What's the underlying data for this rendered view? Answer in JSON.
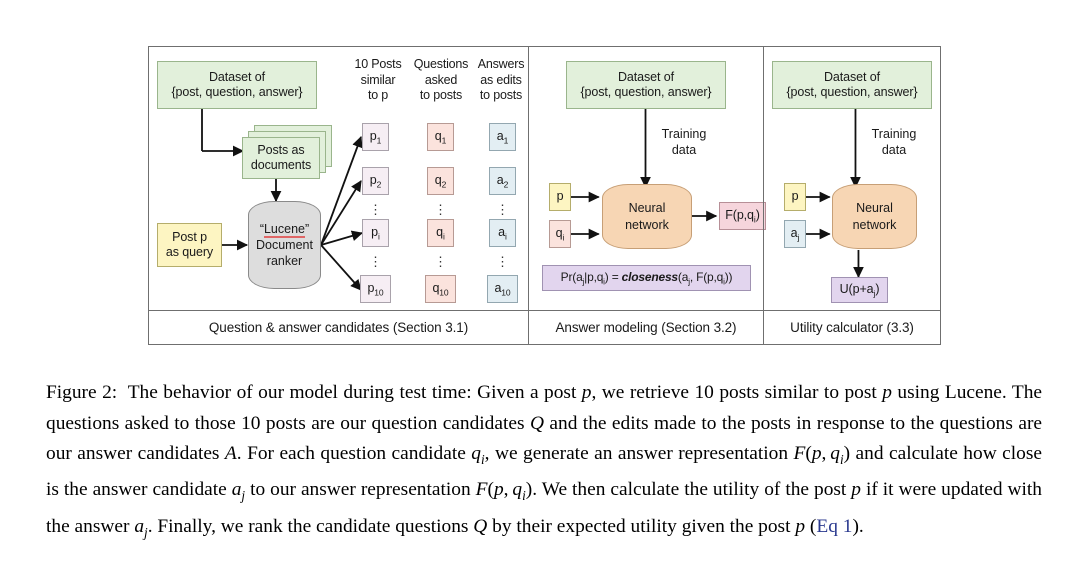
{
  "figure": {
    "panels": [
      {
        "id": "candidates",
        "footer": "Question & answer candidates (Section 3.1)",
        "dataset_box": "Dataset of\n{post, question, answer}",
        "dataset_line1": "Dataset of",
        "dataset_line2": "{post, question, answer}",
        "posts_line1": "Posts as",
        "posts_line2": "documents",
        "query_line1": "Post p",
        "query_line2": "as query",
        "ranker_line1": "“Lucene”",
        "ranker_line1_word": "Lucene",
        "ranker_line2": "Document",
        "ranker_line3": "ranker",
        "col_headers": [
          "10 Posts\nsimilar\nto p",
          "Questions\nasked\nto posts",
          "Answers\nas edits\nto posts"
        ],
        "col_header_posts": [
          "10 Posts",
          "similar",
          "to p"
        ],
        "col_header_questions": [
          "Questions",
          "asked",
          "to posts"
        ],
        "col_header_answers": [
          "Answers",
          "as edits",
          "to posts"
        ],
        "posts_column": [
          "p1",
          "p2",
          "pi",
          "p10"
        ],
        "questions_column": [
          "q1",
          "q2",
          "qi",
          "q10"
        ],
        "answers_column": [
          "a1",
          "a2",
          "ai",
          "a10"
        ],
        "ellipsis": "⋮"
      },
      {
        "id": "answer-modeling",
        "footer": "Answer modeling (Section 3.2)",
        "dataset_line1": "Dataset of",
        "dataset_line2": "{post, question, answer}",
        "training_line1": "Training",
        "training_line2": "data",
        "input_p": "p",
        "input_qi": "qi",
        "network_line1": "Neural",
        "network_line2": "network",
        "output": "F(p,qi)",
        "equation": "Pr(aj|p,qi) = closeness(aj, F(p,qi))",
        "equation_prefix": "Pr(a",
        "equation_emph": "closeness"
      },
      {
        "id": "utility",
        "footer": "Utility calculator (3.3)",
        "dataset_line1": "Dataset of",
        "dataset_line2": "{post, question, answer}",
        "training_line1": "Training",
        "training_line2": "data",
        "input_p": "p",
        "input_aj": "aj",
        "network_line1": "Neural",
        "network_line2": "network",
        "output": "U(p+aj)"
      }
    ]
  },
  "caption": {
    "figure_label": "Figure 2:",
    "text": "The behavior of our model during test time: Given a post p, we retrieve 10 posts similar to post p using Lucene. The questions asked to those 10 posts are our question candidates Q and the edits made to the posts in response to the questions are our answer candidates A. For each question candidate qi, we generate an answer representation F(p, qi) and calculate how close is the answer candidate aj to our answer representation F(p, qi). We then calculate the utility of the post p if it were updated with the answer aj. Finally, we rank the candidate questions Q by their expected utility given the post p (Eq 1).",
    "link_text": "Eq 1"
  },
  "colors": {
    "green": "#e2f0db",
    "yellow": "#fdf5c2",
    "grey": "#dddddd",
    "tan": "#f7d6b4",
    "pbox": "#f6eef4",
    "qbox": "#fbe3dd",
    "abox": "#e3eef3",
    "pink": "#f6d5dc",
    "purple": "#e2d5ee",
    "link": "#2b3a8f",
    "frame": "#6f6f6f"
  }
}
